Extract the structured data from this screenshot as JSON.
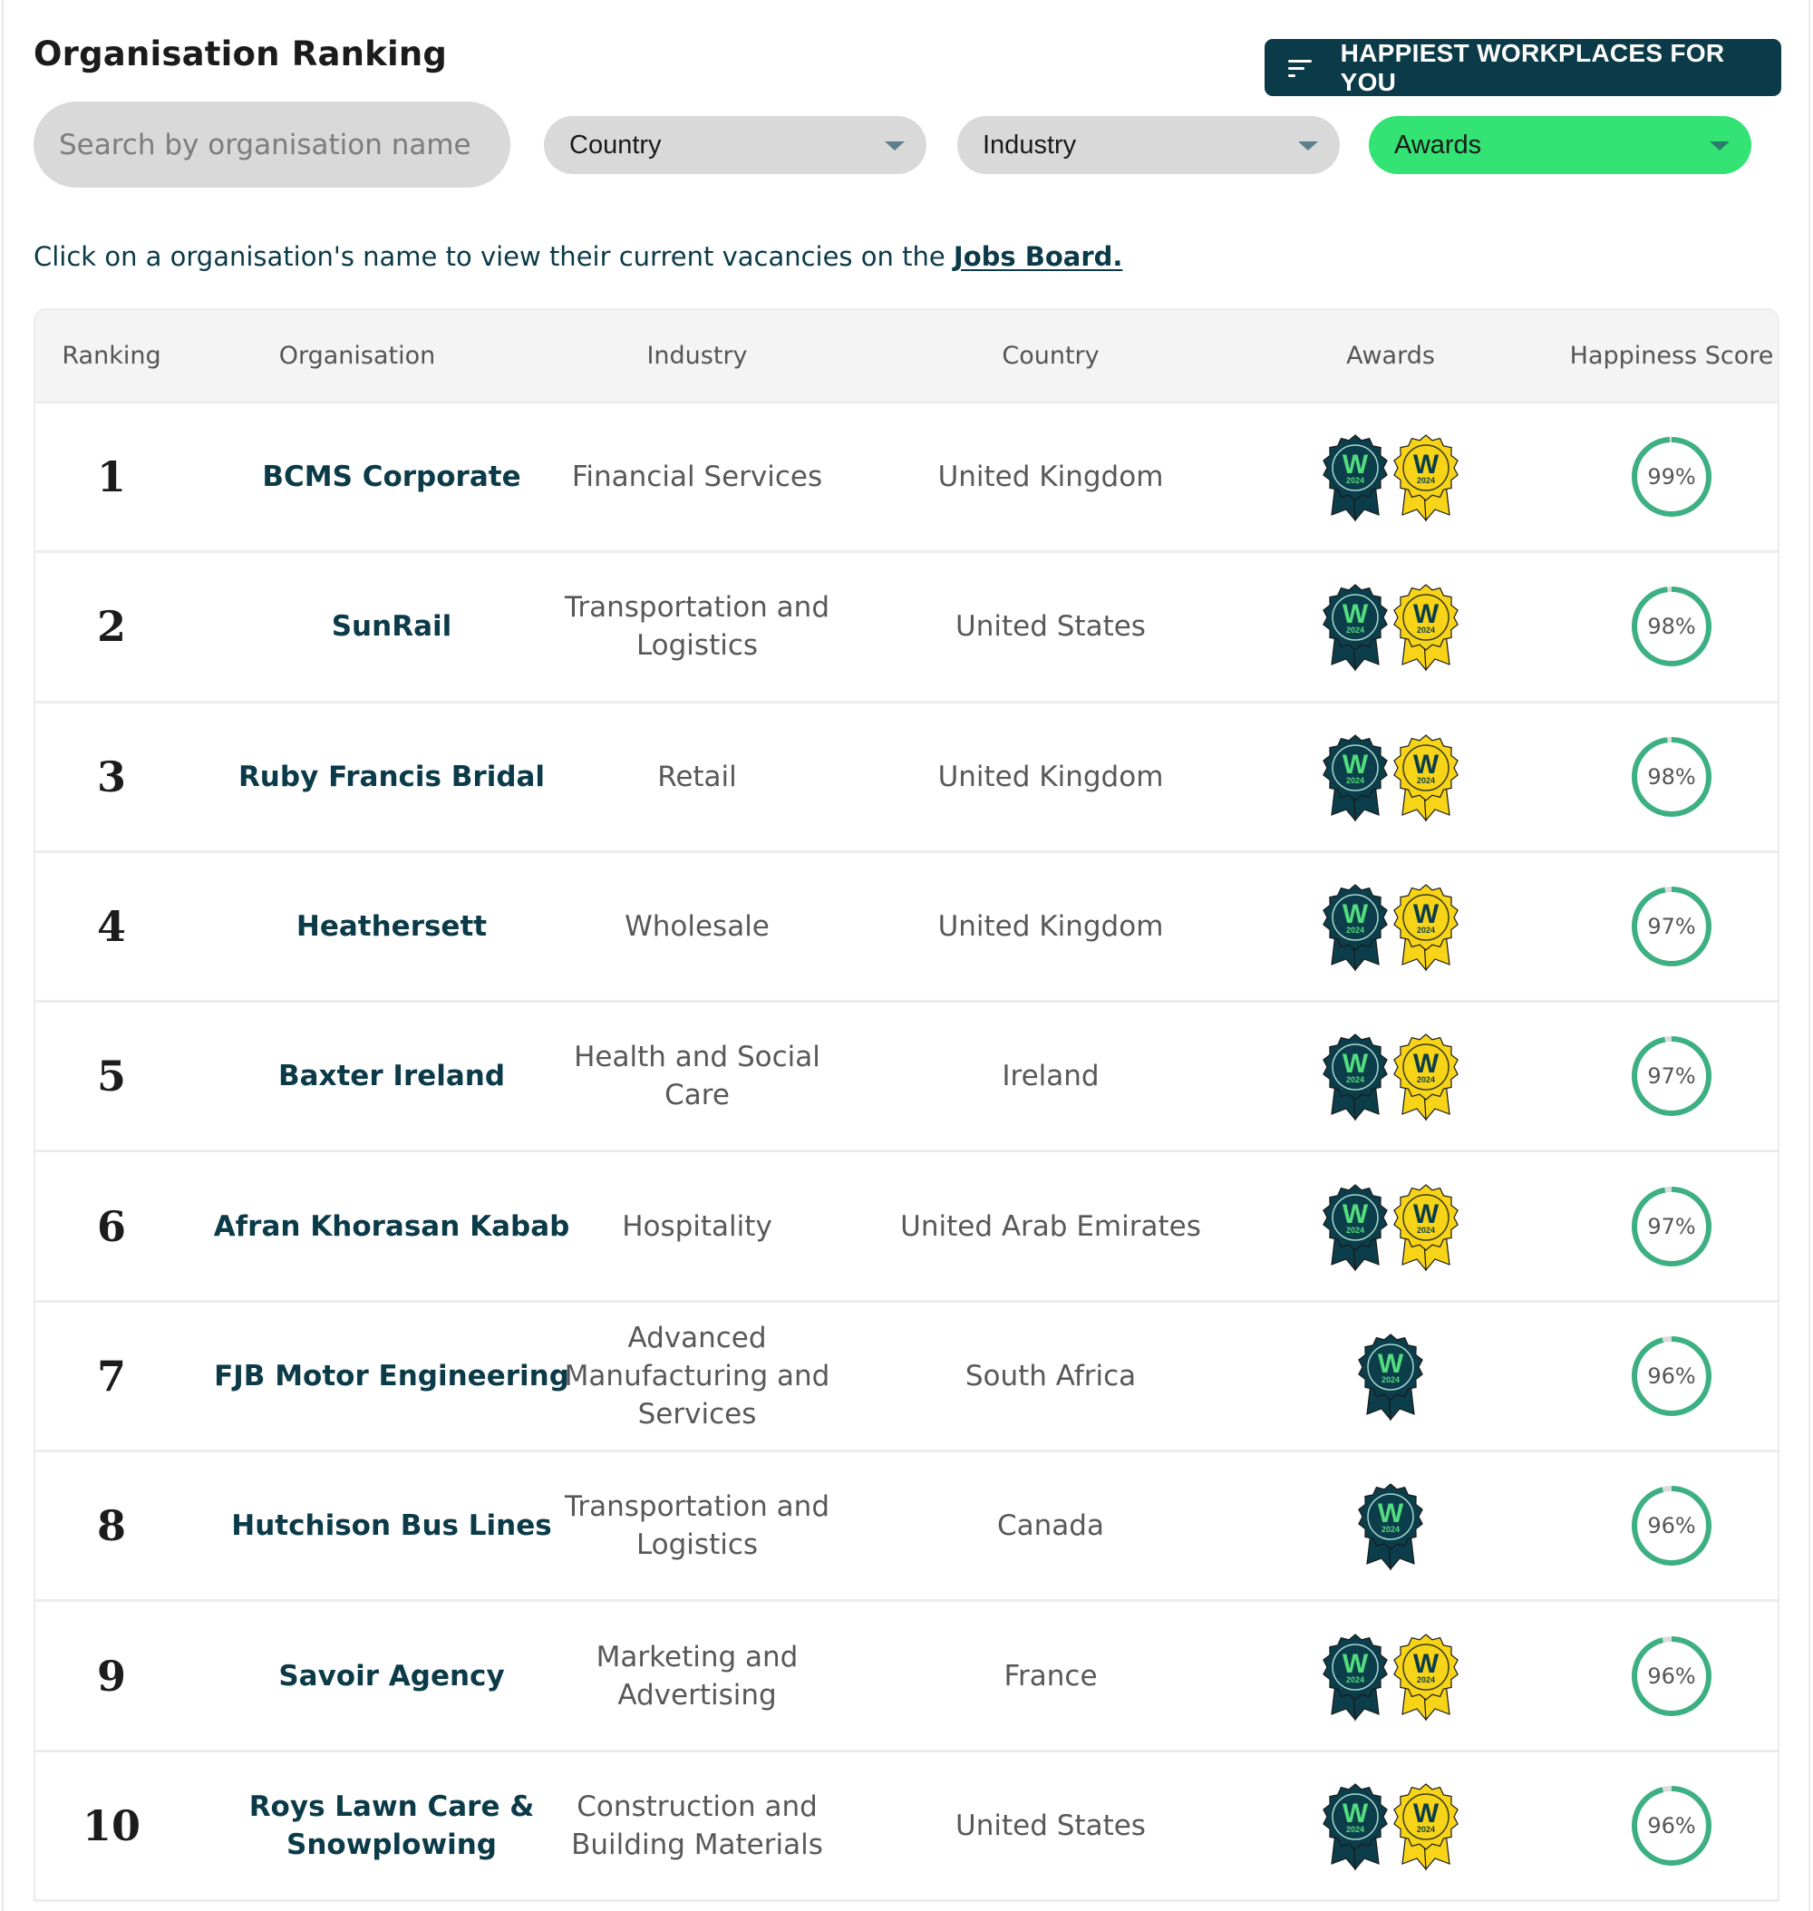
{
  "header": {
    "title": "Organisation Ranking",
    "cta_label": "HAPPIEST WORKPLACES FOR YOU",
    "cta_icon": "filter-lines-icon"
  },
  "filters": {
    "search_placeholder": "Search by organisation name",
    "search_value": "",
    "country_label": "Country",
    "industry_label": "Industry",
    "awards_label": "Awards",
    "awards_active": true
  },
  "info": {
    "text": "Click on a organisation's name to view their current vacancies on the ",
    "link_label": "Jobs Board."
  },
  "colors": {
    "brand_dark": "#0b3a48",
    "awards_active": "#33e374",
    "score_ring": "#3db083",
    "score_track": "#dcdcdc",
    "badge_dark": "#0b3d4a",
    "badge_yellow": "#f7d417",
    "badge_green_text": "#54dd7e"
  },
  "table": {
    "columns": [
      "Ranking",
      "Organisation",
      "Industry",
      "Country",
      "Awards",
      "Happiness Score"
    ],
    "rows": [
      {
        "rank": "1",
        "organisation": "BCMS Corporate",
        "industry": "Financial Services",
        "country": "United Kingdom",
        "awards": [
          {
            "type": "dark",
            "label": "W",
            "year": "2024"
          },
          {
            "type": "yellow",
            "label": "W",
            "year": "2024"
          }
        ],
        "score": 99,
        "score_label": "99%"
      },
      {
        "rank": "2",
        "organisation": "SunRail",
        "industry": "Transportation and Logistics",
        "country": "United States",
        "awards": [
          {
            "type": "dark",
            "label": "W",
            "year": "2024"
          },
          {
            "type": "yellow",
            "label": "W",
            "year": "2024"
          }
        ],
        "score": 98,
        "score_label": "98%"
      },
      {
        "rank": "3",
        "organisation": "Ruby Francis Bridal",
        "industry": "Retail",
        "country": "United Kingdom",
        "awards": [
          {
            "type": "dark",
            "label": "W",
            "year": "2024"
          },
          {
            "type": "yellow",
            "label": "W",
            "year": "2024"
          }
        ],
        "score": 98,
        "score_label": "98%"
      },
      {
        "rank": "4",
        "organisation": "Heathersett",
        "industry": "Wholesale",
        "country": "United Kingdom",
        "awards": [
          {
            "type": "dark",
            "label": "W",
            "year": "2024"
          },
          {
            "type": "yellow",
            "label": "W",
            "year": "2024"
          }
        ],
        "score": 97,
        "score_label": "97%"
      },
      {
        "rank": "5",
        "organisation": "Baxter Ireland",
        "industry": "Health and Social Care",
        "country": "Ireland",
        "awards": [
          {
            "type": "dark",
            "label": "W",
            "year": "2024"
          },
          {
            "type": "yellow",
            "label": "W",
            "year": "2024"
          }
        ],
        "score": 97,
        "score_label": "97%"
      },
      {
        "rank": "6",
        "organisation": "Afran Khorasan Kabab",
        "industry": "Hospitality",
        "country": "United Arab Emirates",
        "awards": [
          {
            "type": "dark",
            "label": "W",
            "year": "2024"
          },
          {
            "type": "yellow",
            "label": "W",
            "year": "2024"
          }
        ],
        "score": 97,
        "score_label": "97%"
      },
      {
        "rank": "7",
        "organisation": "FJB Motor Engineering",
        "industry": "Advanced Manufacturing and Services",
        "country": "South Africa",
        "awards": [
          {
            "type": "dark",
            "label": "W",
            "year": "2024"
          }
        ],
        "score": 96,
        "score_label": "96%"
      },
      {
        "rank": "8",
        "organisation": "Hutchison Bus Lines",
        "industry": "Transportation and Logistics",
        "country": "Canada",
        "awards": [
          {
            "type": "dark",
            "label": "W",
            "year": "2024"
          }
        ],
        "score": 96,
        "score_label": "96%"
      },
      {
        "rank": "9",
        "organisation": "Savoir Agency",
        "industry": "Marketing and Advertising",
        "country": "France",
        "awards": [
          {
            "type": "dark",
            "label": "W",
            "year": "2024"
          },
          {
            "type": "yellow",
            "label": "W",
            "year": "2024"
          }
        ],
        "score": 96,
        "score_label": "96%"
      },
      {
        "rank": "10",
        "organisation": "Roys Lawn Care & Snowplowing",
        "industry": "Construction and Building Materials",
        "country": "United States",
        "awards": [
          {
            "type": "dark",
            "label": "W",
            "year": "2024"
          },
          {
            "type": "yellow",
            "label": "W",
            "year": "2024"
          }
        ],
        "score": 96,
        "score_label": "96%"
      }
    ]
  }
}
